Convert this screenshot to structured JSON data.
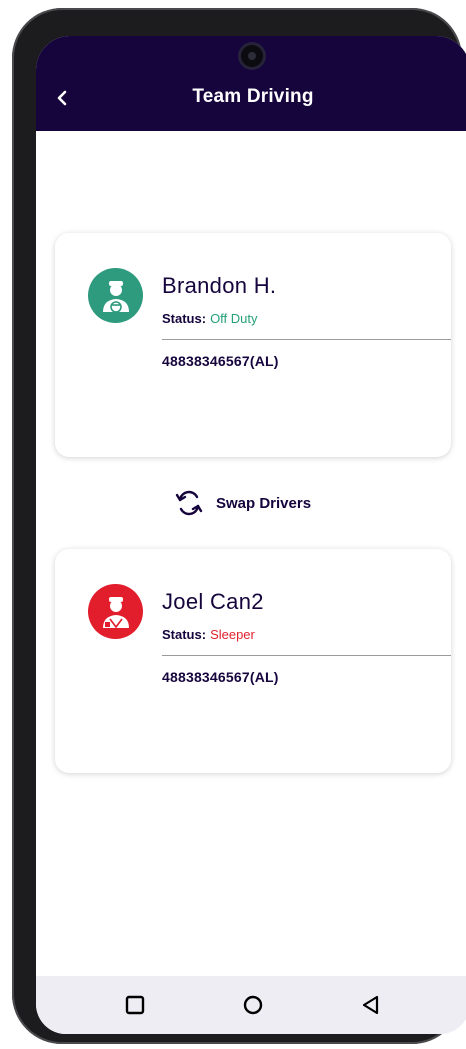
{
  "header": {
    "title": "Team Driving",
    "back_icon": "chevron-left-icon"
  },
  "drivers": [
    {
      "name": "Brandon H.",
      "status_label": "Status:",
      "status_value": "Off Duty",
      "status_color": "#27a07a",
      "avatar_color": "#2e9a7e",
      "id": "48838346567(AL)"
    },
    {
      "name": "Joel Can2",
      "status_label": "Status:",
      "status_value": "Sleeper",
      "status_color": "#e0222e",
      "avatar_color": "#e21d2c",
      "id": "48838346567(AL)"
    }
  ],
  "swap": {
    "label": "Swap Drivers",
    "icon": "swap-arrows-icon"
  },
  "nav": {
    "items": [
      "recent-apps-icon",
      "home-icon",
      "back-triangle-icon"
    ]
  },
  "colors": {
    "appbar": "#16053d",
    "text_primary": "#16053d"
  }
}
